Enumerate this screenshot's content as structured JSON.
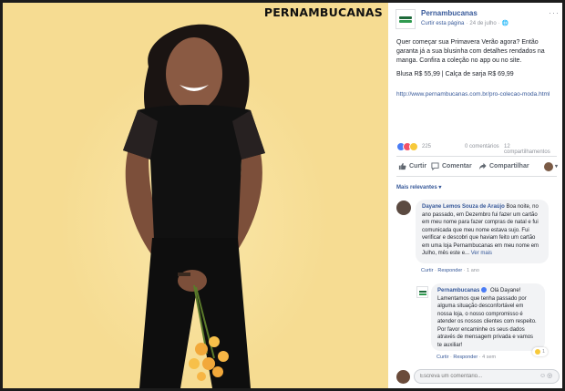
{
  "photo": {
    "brand_logo": "PERNAMBUCANAS"
  },
  "post": {
    "page_name": "Pernambucanas",
    "follow_label": "Curtir esta página",
    "date": "24 de julho",
    "menu_icon": "ellipsis-icon",
    "text": "Quer começar sua Primavera Verão agora? Então garanta já a sua blusinha com detalhes rendados na manga. Confira a coleção no app ou no site.",
    "price_text": "Blusa R$ 55,99 | Calça de sarja R$ 69,99",
    "link": "http://www.pernambucanas.com.br/pro-colecao-moda.html"
  },
  "stats": {
    "reactions": "225",
    "comments": "0 comentários",
    "shares": "12 compartilhamentos"
  },
  "actions": {
    "like": "Curtir",
    "comment": "Comentar",
    "share": "Compartilhar"
  },
  "sort_label": "Mais relevantes ▾",
  "comment": {
    "author": "Dayane Lemos Souza de Araújo",
    "text": "Boa noite, no ano passado, em Dezembro fui fazer um cartão em meu nome para fazer compras de natal e fui comunicada que meu nome estava sujo. Fui verificar e descobri que haviam feito um cartão em uma loja Pernambucanas em meu nome em Julho, mês este e...",
    "see_more": "Ver mais",
    "like_link": "Curtir",
    "reply_link": "Responder",
    "time": "1 ano"
  },
  "reply": {
    "author": "Pernambucanas",
    "greeting": "Olá Dayane!",
    "text": "Lamentamos que tenha passado por alguma situação desconfortável em nossa loja, o nosso compromisso é atender os nossos clientes com respeito. Por favor encaminhe os seus dados através de mensagem privada e vamos te auxiliar!",
    "reaction_count": "1",
    "like_link": "Curtir",
    "reply_link": "Responder",
    "time": "4 sem"
  },
  "composer": {
    "placeholder": "Escreva um comentário..."
  },
  "colors": {
    "background_photo": "#f6dc92",
    "fb_blue": "#365899",
    "muted": "#90949c"
  }
}
